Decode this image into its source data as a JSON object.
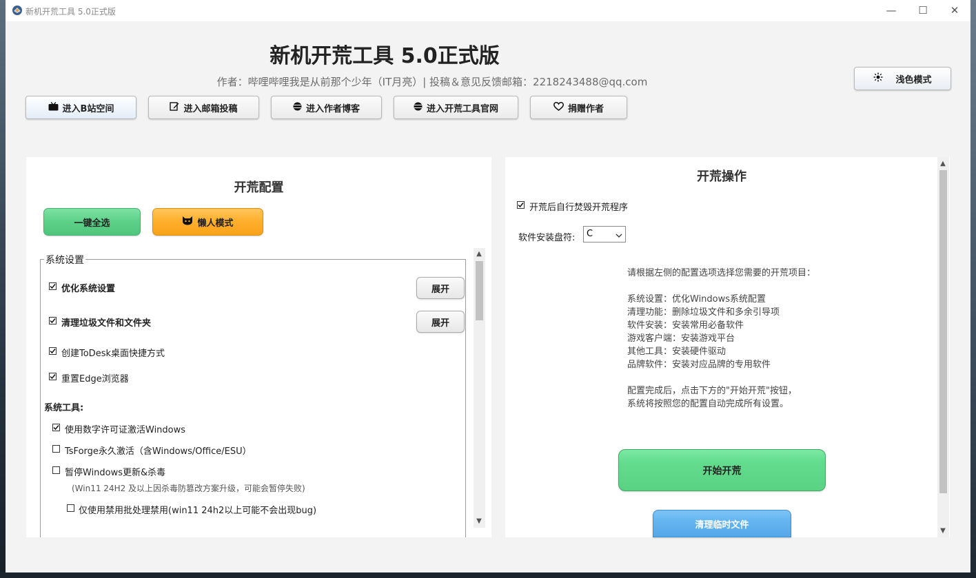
{
  "window": {
    "title": "新机开荒工具 5.0正式版",
    "controls": {
      "minimize": "—",
      "maximize": "☐",
      "close": "✕"
    }
  },
  "header": {
    "title": "新机开荒工具 5.0正式版",
    "author": "作者：哔哩哔哩我是从前那个少年（IT月亮）| 投稿＆意见反馈邮箱：2218243488@qq.com",
    "theme_button": "浅色模式"
  },
  "nav_buttons": [
    {
      "label": "进入B站空间",
      "icon": "tv-icon"
    },
    {
      "label": "进入邮箱投稿",
      "icon": "edit-icon"
    },
    {
      "label": "进入作者博客",
      "icon": "globe-icon"
    },
    {
      "label": "进入开荒工具官网",
      "icon": "globe-icon"
    },
    {
      "label": "捐赠作者",
      "icon": "heart-icon"
    }
  ],
  "config_panel": {
    "title": "开荒配置",
    "select_all": "一键全选",
    "lazy_mode": "懒人模式",
    "group_title": "系统设置",
    "items": [
      {
        "label": "优化系统设置",
        "checked": true,
        "expand": "展开"
      },
      {
        "label": "清理垃圾文件和文件夹",
        "checked": true,
        "expand": "展开"
      },
      {
        "label": "创建ToDesk桌面快捷方式",
        "checked": true
      },
      {
        "label": "重置Edge浏览器",
        "checked": true
      }
    ],
    "tools_title": "系统工具:",
    "tools": [
      {
        "label": "使用数字许可证激活Windows",
        "checked": true
      },
      {
        "label": "TsForge永久激活（含Windows/Office/ESU）",
        "checked": false
      },
      {
        "label": "暂停Windows更新&杀毒",
        "checked": false
      }
    ],
    "note": "(Win11 24H2 及以上因杀毒防篡改方案升级，可能会暂停失败)",
    "sub_option": {
      "label": "仅使用禁用批处理禁用(win11 24h2以上可能不会出现bug)",
      "checked": false
    }
  },
  "action_panel": {
    "title": "开荒操作",
    "self_destruct": {
      "label": "开荒后自行焚毁开荒程序",
      "checked": true
    },
    "drive_label": "软件安装盘符:",
    "drive_value": "C",
    "info": [
      "请根据左侧的配置选项选择您需要的开荒项目：",
      "",
      "系统设置：优化Windows系统配置",
      "清理功能：删除垃圾文件和多余引导项",
      "软件安装：安装常用必备软件",
      "游戏客户端：安装游戏平台",
      "其他工具：安装硬件驱动",
      "品牌软件：安装对应品牌的专用软件",
      "",
      "配置完成后，点击下方的\"开始开荒\"按钮，",
      "系统将按照您的配置自动完成所有设置。"
    ],
    "start_button": "开始开荒",
    "clean_button": "清理临时文件"
  },
  "colors": {
    "select_all": "#5fd18a",
    "lazy_mode": "#ffb02e",
    "start": "#63dc8d",
    "clean": "#64b5f0"
  }
}
